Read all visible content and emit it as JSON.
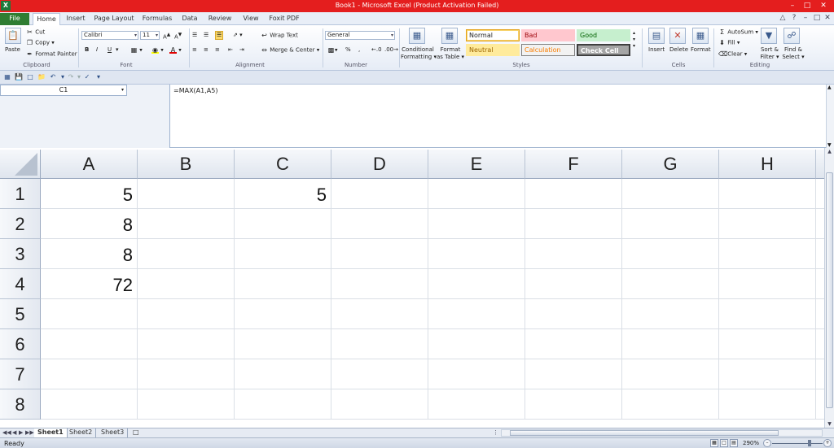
{
  "window": {
    "title": "Book1 - Microsoft Excel (Product Activation Failed)",
    "app_icon": "excel-icon"
  },
  "tabs": [
    {
      "label": "File"
    },
    {
      "label": "Home"
    },
    {
      "label": "Insert"
    },
    {
      "label": "Page Layout"
    },
    {
      "label": "Formulas"
    },
    {
      "label": "Data"
    },
    {
      "label": "Review"
    },
    {
      "label": "View"
    },
    {
      "label": "Foxit PDF"
    }
  ],
  "ribbon": {
    "clipboard": {
      "paste": "Paste",
      "cut": "Cut",
      "copy": "Copy",
      "format_painter": "Format Painter",
      "label": "Clipboard"
    },
    "font": {
      "name": "Calibri",
      "size": "11",
      "label": "Font",
      "bold": "B",
      "italic": "I",
      "underline": "U"
    },
    "alignment": {
      "wrap_text": "Wrap Text",
      "merge_center": "Merge & Center",
      "label": "Alignment"
    },
    "number": {
      "format": "General",
      "percent": "%",
      "comma": ",",
      "label": "Number"
    },
    "styles": {
      "conditional_formatting_1": "Conditional",
      "conditional_formatting_2": "Formatting",
      "format_as_table_1": "Format",
      "format_as_table_2": "as Table",
      "normal": "Normal",
      "bad": "Bad",
      "good": "Good",
      "neutral": "Neutral",
      "calculation": "Calculation",
      "check_cell": "Check Cell",
      "label": "Styles"
    },
    "cells": {
      "insert": "Insert",
      "delete": "Delete",
      "format": "Format",
      "label": "Cells"
    },
    "editing": {
      "autosum": "AutoSum",
      "fill": "Fill",
      "clear": "Clear",
      "sort_filter_1": "Sort &",
      "sort_filter_2": "Filter",
      "find_select_1": "Find &",
      "find_select_2": "Select",
      "label": "Editing"
    }
  },
  "formula_bar": {
    "name_box": "C1",
    "formula": "=MAX(A1,A5)"
  },
  "grid": {
    "columns": [
      "A",
      "B",
      "C",
      "D",
      "E",
      "F",
      "G",
      "H"
    ],
    "rows": [
      "1",
      "2",
      "3",
      "4",
      "5",
      "6",
      "7",
      "8"
    ],
    "cells": {
      "A1": "5",
      "A2": "8",
      "A3": "8",
      "A4": "72",
      "C1": "5"
    }
  },
  "sheets": [
    {
      "name": "Sheet1",
      "active": true
    },
    {
      "name": "Sheet2",
      "active": false
    },
    {
      "name": "Sheet3",
      "active": false
    }
  ],
  "status": {
    "ready": "Ready",
    "zoom": "290%"
  },
  "colors": {
    "title_bar": "#e41e1e",
    "file_tab": "#2f7d32",
    "style_bad_bg": "#ffc7ce",
    "style_good_bg": "#c6efce",
    "style_neutral_bg": "#ffeb9c",
    "style_check_cell_bg": "#a5a5a5"
  }
}
